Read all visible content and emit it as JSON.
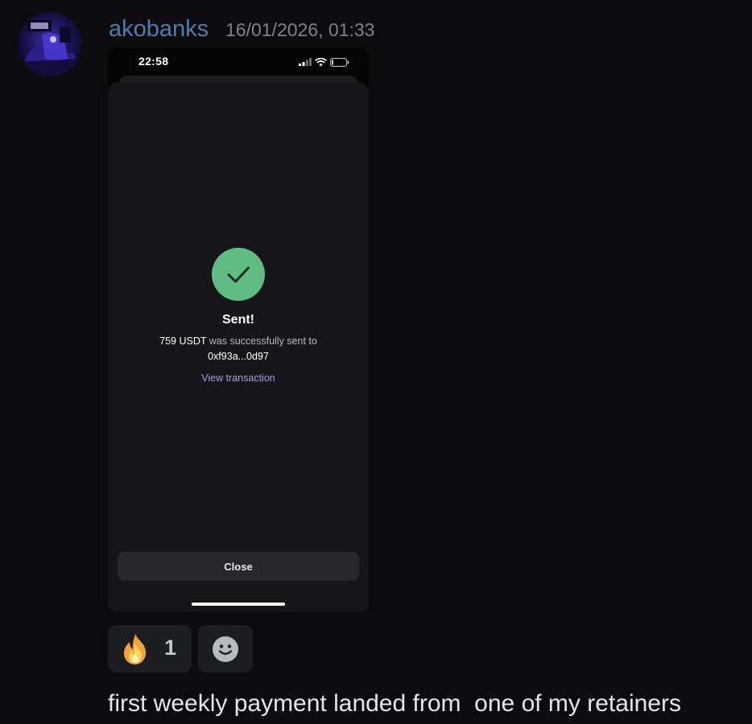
{
  "message": {
    "username": "akobanks",
    "timestamp": "16/01/2026, 01:33",
    "text": "first weekly payment landed from  one of my retainers"
  },
  "screenshot": {
    "status_time": "22:58",
    "sent_title": "Sent!",
    "amount": "759 USDT",
    "sent_suffix": " was successfully sent to",
    "address": "0xf93a...0d97",
    "view_link": "View transaction",
    "close_label": "Close"
  },
  "reactions": [
    {
      "emoji": "fire-emoji",
      "count": "1"
    },
    {
      "emoji": "add-reaction-icon"
    }
  ],
  "colors": {
    "username": "#4a7fb0",
    "success_green": "#5fbc82",
    "link_purple": "#a79bea"
  }
}
